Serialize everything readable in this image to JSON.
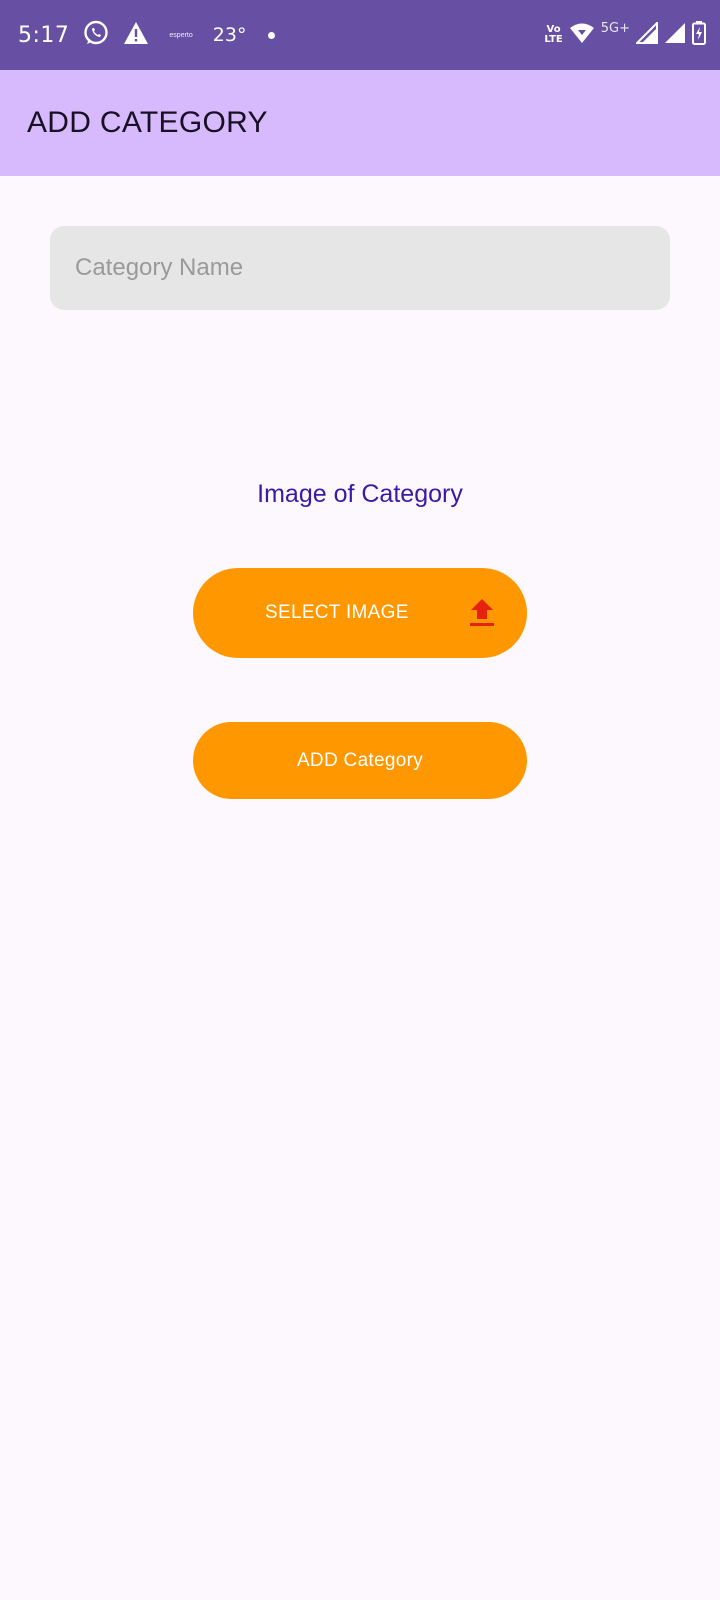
{
  "status_bar": {
    "time": "5:17",
    "tiny_text": "esperto",
    "temperature": "23°",
    "volte_top": "Vo",
    "volte_bottom": "LTE",
    "network": "5G+"
  },
  "app_bar": {
    "title": "ADD CATEGORY"
  },
  "form": {
    "name_placeholder": "Category Name",
    "name_value": "",
    "image_label": "Image of Category",
    "select_image_label": "SELECT IMAGE",
    "add_button_label": "ADD Category"
  },
  "colors": {
    "status_bar": "#6750a4",
    "app_bar": "#d7bafd",
    "button": "#ff9800",
    "upload_icon": "#e8200e",
    "label_text": "#3a1aa3"
  },
  "icons": {
    "status_left": [
      "whatsapp-icon",
      "warning-icon"
    ],
    "status_right": [
      "wifi-icon",
      "signal-icon",
      "signal-icon",
      "battery-icon"
    ],
    "select_image": "upload-icon"
  }
}
